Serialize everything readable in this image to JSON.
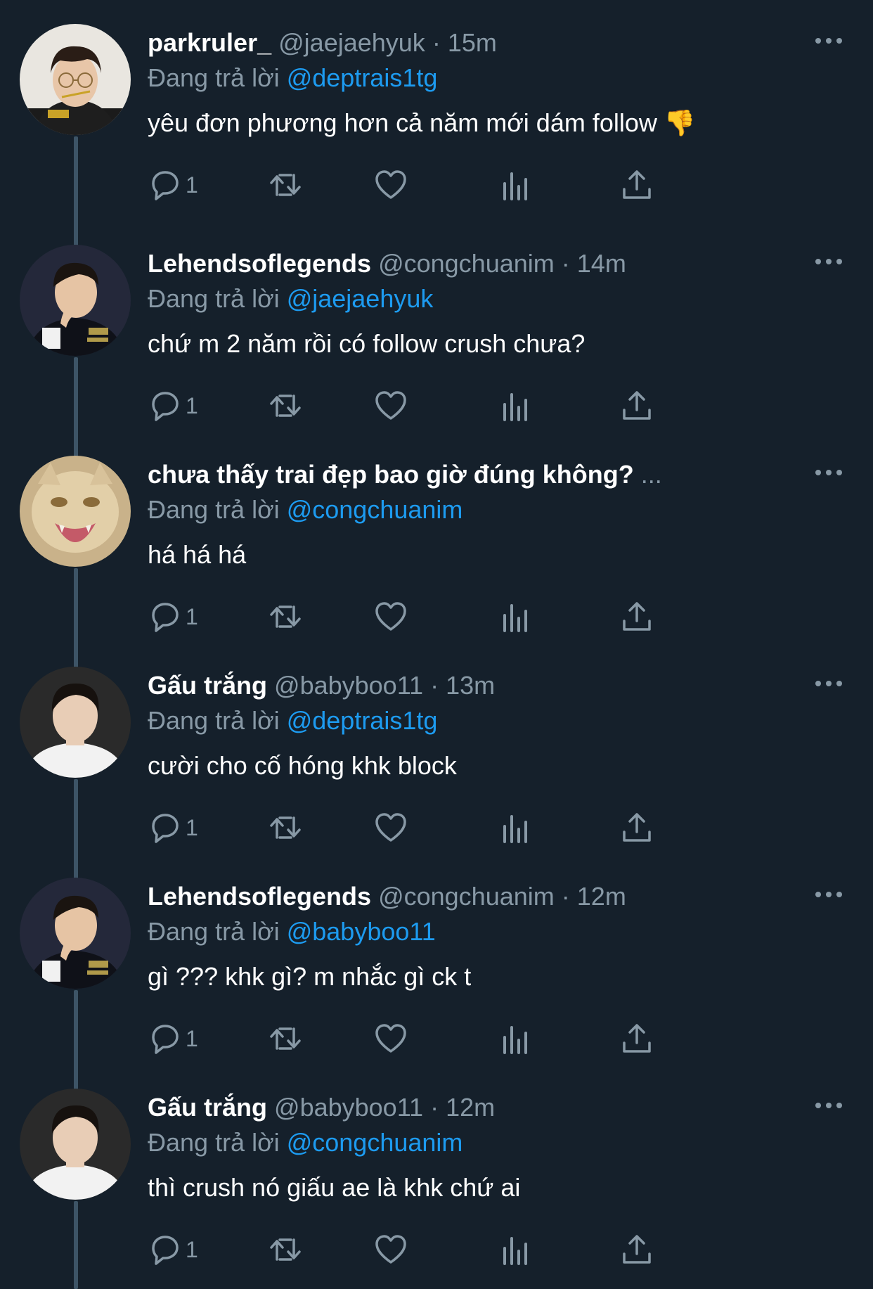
{
  "colors": {
    "background": "#15202b",
    "primary_text": "#ffffff",
    "secondary_text": "#8899a6",
    "mention": "#1d9bf0",
    "thread_line": "#3d5466"
  },
  "replying_prefix": "Đang trả lời",
  "tweets": [
    {
      "display_name": "parkruler_",
      "handle": "@jaejaehyuk",
      "separator": "·",
      "time": "15m",
      "reply_to": "@deptrais1tg",
      "text": "yêu đơn phương hơn cả năm mới dám follow",
      "emoji": "👎",
      "reply_count": "1",
      "avatar": "avatar-glasses-icon"
    },
    {
      "display_name": "Lehendsoflegends",
      "handle": "@congchuanim",
      "separator": "·",
      "time": "14m",
      "reply_to": "@jaejaehyuk",
      "text": "chứ m 2 năm rồi có follow crush chưa?",
      "reply_count": "1",
      "avatar": "avatar-jacket-icon"
    },
    {
      "display_name": "chưa thấy trai đẹp bao giờ đúng không?",
      "truncation": "...",
      "reply_to": "@congchuanim",
      "text": "há há há",
      "reply_count": "1",
      "avatar": "avatar-cat-icon"
    },
    {
      "display_name": "Gấu trắng",
      "handle": "@babyboo11",
      "separator": "·",
      "time": "13m",
      "reply_to": "@deptrais1tg",
      "text": "cười cho cố hóng khk block",
      "reply_count": "1",
      "avatar": "avatar-white-shirt-icon"
    },
    {
      "display_name": "Lehendsoflegends",
      "handle": "@congchuanim",
      "separator": "·",
      "time": "12m",
      "reply_to": "@babyboo11",
      "text": "gì ??? khk gì? m nhắc gì ck t",
      "reply_count": "1",
      "avatar": "avatar-jacket-icon"
    },
    {
      "display_name": "Gấu trắng",
      "handle": "@babyboo11",
      "separator": "·",
      "time": "12m",
      "reply_to": "@congchuanim",
      "text": "thì crush nó giấu ae là khk chứ ai",
      "reply_count": "1",
      "avatar": "avatar-white-shirt-icon"
    }
  ],
  "icons": {
    "reply": "reply-icon",
    "retweet": "retweet-icon",
    "like": "heart-icon",
    "analytics": "analytics-icon",
    "share": "share-icon",
    "more": "more-icon"
  }
}
